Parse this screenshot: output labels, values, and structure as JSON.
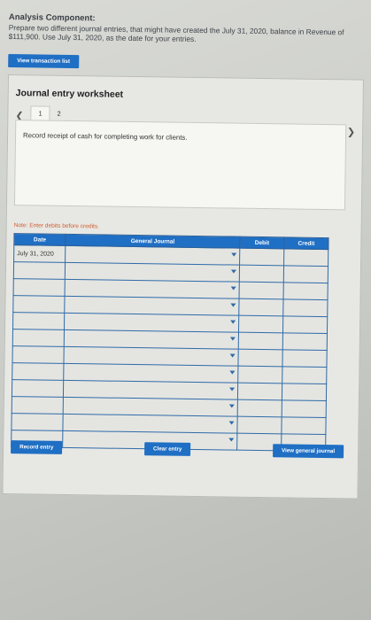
{
  "section": {
    "heading": "Analysis Component:",
    "instructions": "Prepare two different journal entries, that might have created the July 31, 2020, balance in Revenue of $111,900. Use July 31, 2020, as the date for your entries."
  },
  "buttons": {
    "view_transaction_list": "View transaction list",
    "record_entry": "Record entry",
    "clear_entry": "Clear entry",
    "view_general_journal": "View general journal"
  },
  "worksheet": {
    "title": "Journal entry worksheet",
    "pages": [
      "1",
      "2"
    ],
    "active_page": "1",
    "description": "Record receipt of cash for completing work for clients.",
    "note": "Note: Enter debits before credits."
  },
  "table": {
    "headers": {
      "date": "Date",
      "general_journal": "General Journal",
      "debit": "Debit",
      "credit": "Credit"
    },
    "rows": [
      {
        "date": "July 31, 2020"
      },
      {
        "date": ""
      },
      {
        "date": ""
      },
      {
        "date": ""
      },
      {
        "date": ""
      },
      {
        "date": ""
      },
      {
        "date": ""
      },
      {
        "date": ""
      },
      {
        "date": ""
      },
      {
        "date": ""
      },
      {
        "date": ""
      },
      {
        "date": ""
      }
    ]
  },
  "icons": {
    "prev": "chevron-left-icon",
    "next": "chevron-right-icon",
    "dropdown": "dropdown-arrow-icon"
  }
}
